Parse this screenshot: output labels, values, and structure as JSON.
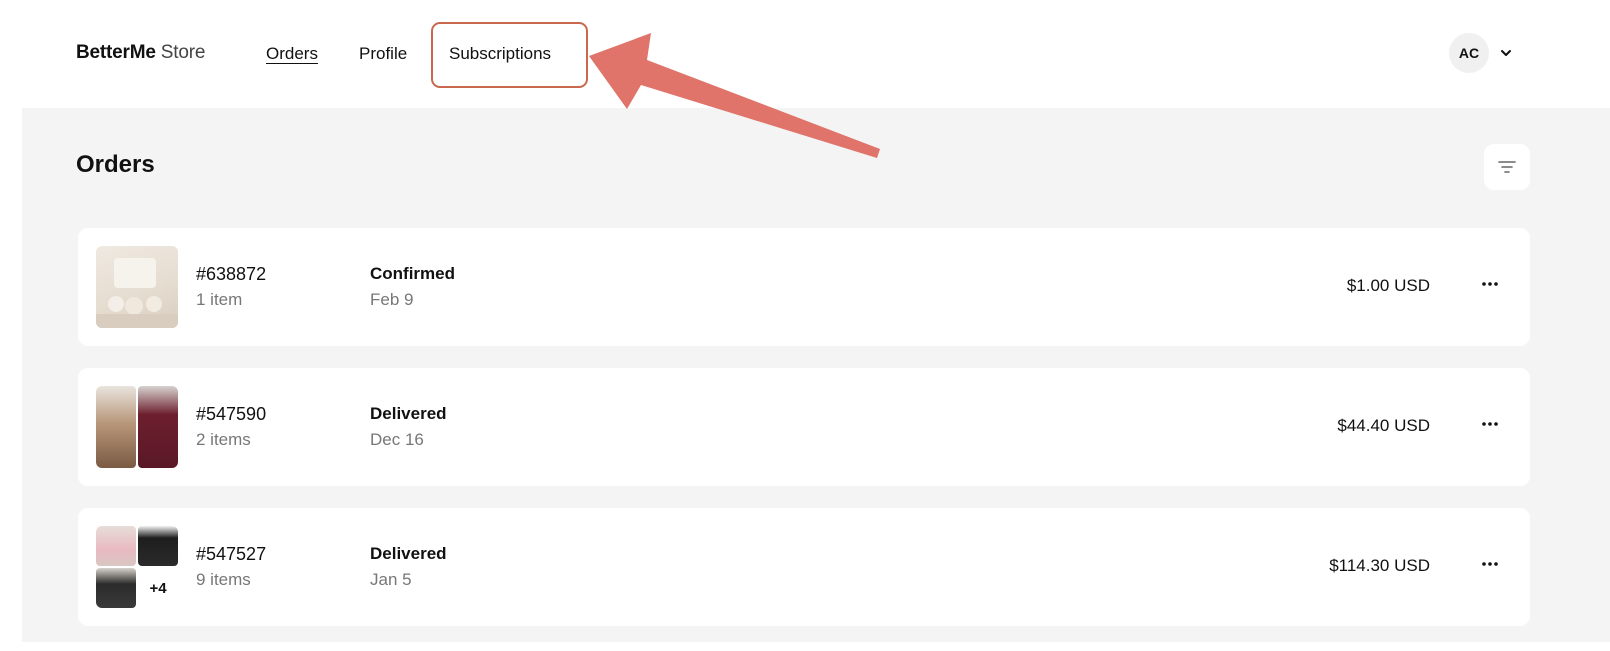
{
  "header": {
    "brand_primary": "BetterMe",
    "brand_secondary": "Store",
    "nav": {
      "orders": "Orders",
      "profile": "Profile",
      "subscriptions": "Subscriptions"
    },
    "user_initials": "AC",
    "user_menu_icon": "chevron-down-icon"
  },
  "main": {
    "title": "Orders",
    "filter_icon": "filter-icon",
    "orders": [
      {
        "number": "#638872",
        "items": "1 item",
        "status": "Confirmed",
        "date": "Feb 9",
        "total": "$1.00 USD"
      },
      {
        "number": "#547590",
        "items": "2 items",
        "status": "Delivered",
        "date": "Dec 16",
        "total": "$44.40 USD"
      },
      {
        "number": "#547527",
        "items": "9 items",
        "status": "Delivered",
        "date": "Jan 5",
        "total": "$114.30 USD",
        "extra_count": "+4"
      }
    ],
    "more_icon": "more-horizontal-icon"
  },
  "annotation": {
    "highlight_color": "#c8694f",
    "arrow_color": "#e0736a"
  }
}
